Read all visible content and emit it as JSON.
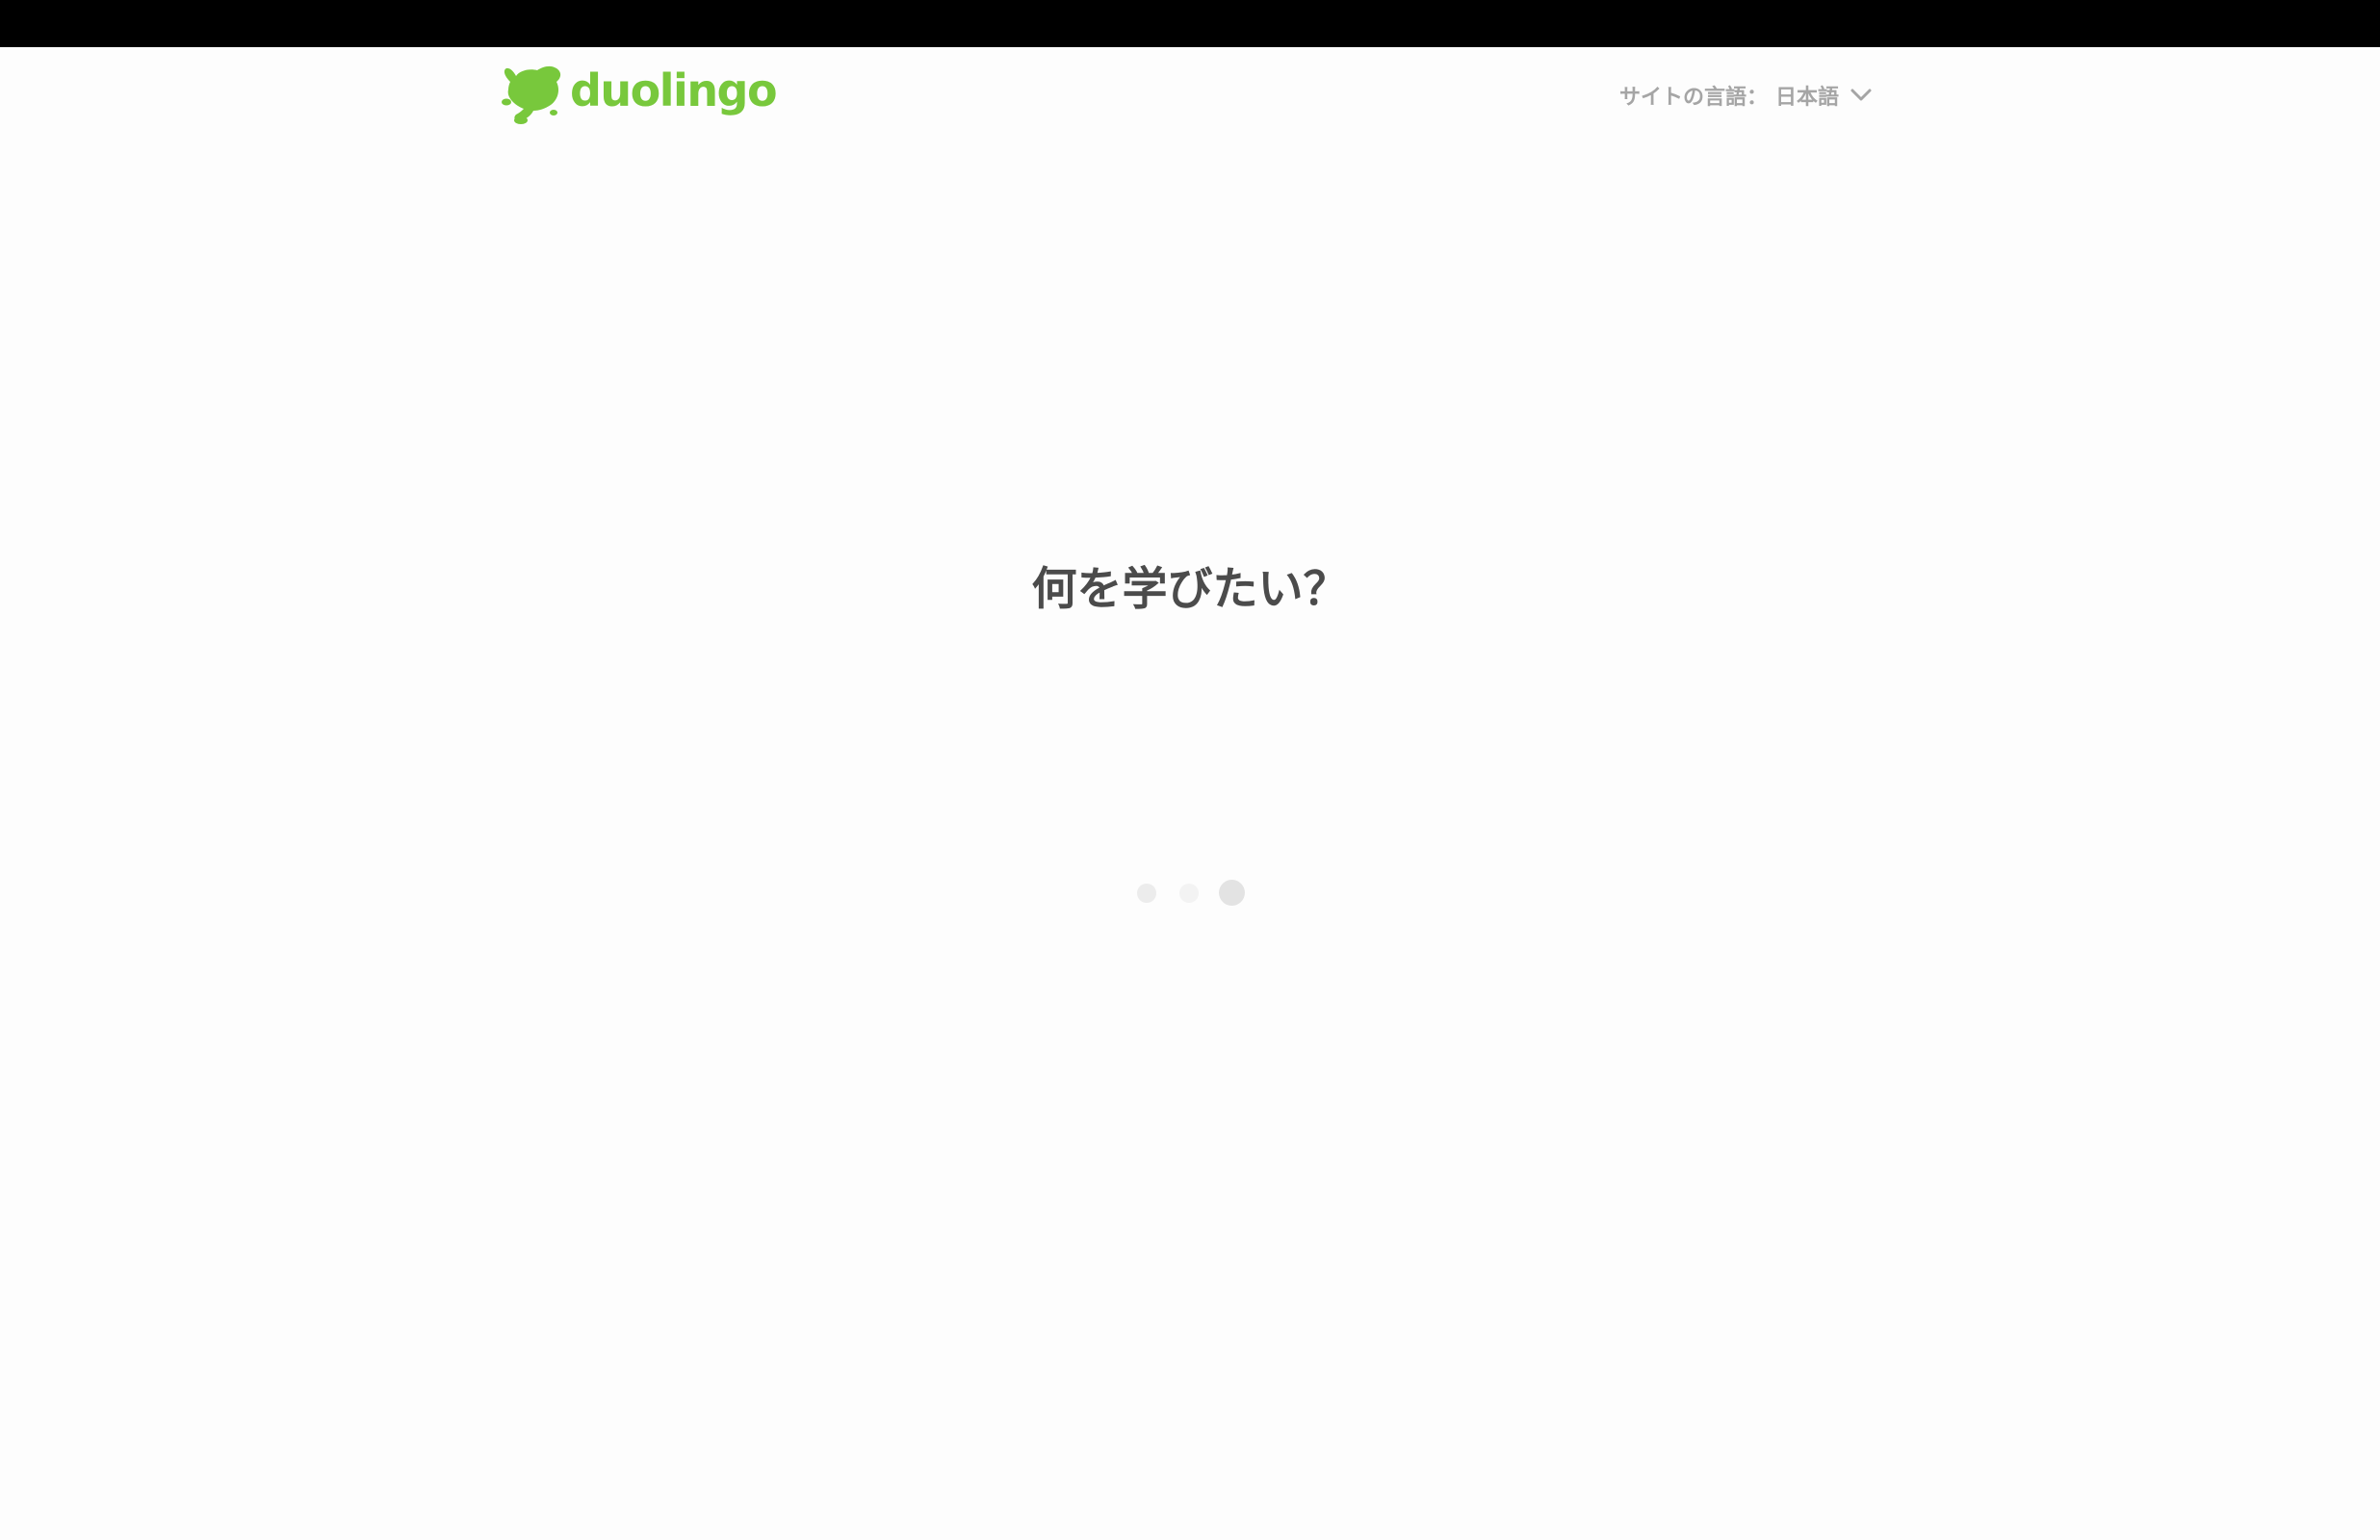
{
  "header": {
    "logo_text": "duolingo",
    "site_language_label": "サイトの言語：",
    "site_language_value": "日本語",
    "chevron_icon": "chevron-down-icon"
  },
  "main": {
    "question": "何を学びたい？",
    "loading_indicator": {
      "dots": 3,
      "active_dot": 3
    }
  },
  "colors": {
    "brand": "#78c83c",
    "text": "#4b4b4b",
    "muted": "#a5a5a5",
    "background": "#fdfdfd",
    "top_bar": "#000000"
  }
}
